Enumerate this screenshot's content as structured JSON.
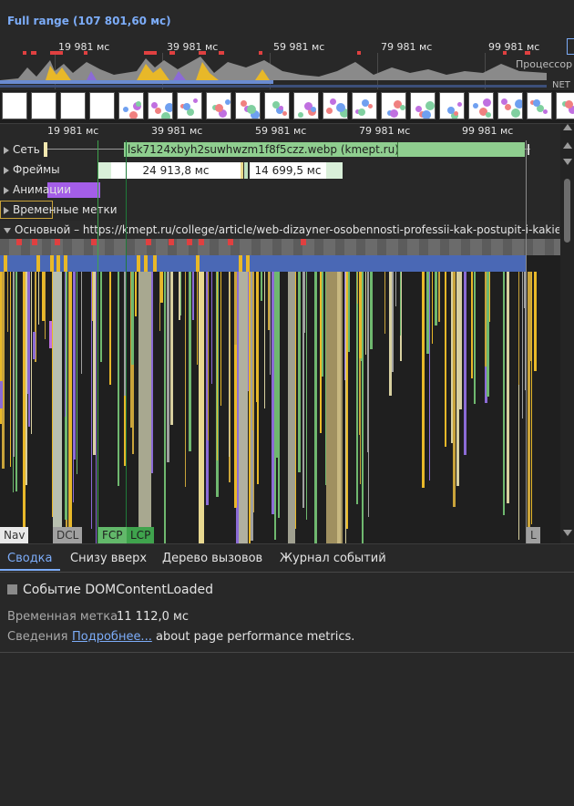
{
  "overview": {
    "full_range": "Full range (107 801,60 мс)",
    "ticks": [
      "19 981 мс",
      "39 981 мс",
      "59 981 мс",
      "79 981 мс",
      "99 981 мс"
    ],
    "cpu_label": "Процессор",
    "net_label": "NET"
  },
  "ruler": {
    "ticks": [
      "19 981 мс",
      "39 981 мс",
      "59 981 мс",
      "79 981 мс",
      "99 981 мс"
    ]
  },
  "tracks": {
    "network": {
      "label": "Сеть",
      "item": "lsk7124xbyh2suwhwzm1f8f5czz.webp (kmept.ru)"
    },
    "frames": {
      "label": "Фреймы",
      "box1": "24 913,8 мс",
      "box2": "14 699,5 мс"
    },
    "animations": {
      "label": "Анимации"
    },
    "timings": {
      "label": "Временные метки"
    },
    "main": {
      "label": "Основной – https://kmept.ru/college/article/web-dizayner-osobennosti-professii-kak-postupit-i-kakie-ekzameny-sdavat"
    }
  },
  "markers": {
    "nav": "Nav",
    "dcl": "DCL",
    "fcp": "FCP",
    "lcp": "LCP",
    "l": "L"
  },
  "bottom": {
    "tabs": [
      "Сводка",
      "Снизу вверх",
      "Дерево вызовов",
      "Журнал событий"
    ],
    "event_title": "Событие DOMContentLoaded",
    "timestamp_key": "Временная метка",
    "timestamp_val": "11 112,0 мс",
    "details_key": "Сведения",
    "details_link": "Подробнее...",
    "details_text": "about page performance metrics."
  },
  "colors": {
    "accent": "#7cacf8",
    "network": "#8fce8f",
    "animation": "#a45ee8",
    "scripting": "#f2c94c",
    "rendering": "#8b6bd6",
    "painting": "#6fb86f"
  }
}
